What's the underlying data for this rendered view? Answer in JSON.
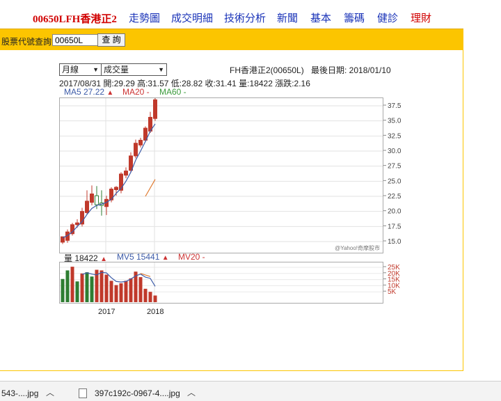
{
  "nav": {
    "stock_title": "00650LFH香港正2",
    "links": [
      "走勢圖",
      "成交明細",
      "技術分析",
      "新聞",
      "基本",
      "籌碼",
      "健診",
      "理財"
    ]
  },
  "search": {
    "label": "股票代號查詢",
    "value": "00650L",
    "button": "查 詢"
  },
  "chart": {
    "period_select": "月線",
    "indicator_select": "成交量",
    "stock_name": "FH香港正2(00650L)",
    "last_date_label": "最後日期: 2018/01/10",
    "ohlc_line": "2017/08/31 開:29.29 高:31.57 低:28.82 收:31.41 量:18422 漲跌:2.16",
    "ma5": "MA5 27.22",
    "ma20": "MA20 -",
    "ma60": "MA60 -",
    "vol_label": "量 18422",
    "mv5": "MV5 15441",
    "mv20": "MV20 -",
    "watermark": "@Yahoo!奇摩股市",
    "price_ticks": [
      "37.5",
      "35.0",
      "32.5",
      "30.0",
      "27.5",
      "25.0",
      "22.5",
      "20.0",
      "17.5",
      "15.0"
    ],
    "volume_ticks": [
      "25K",
      "20K",
      "15K",
      "10K",
      "5K"
    ],
    "x_ticks": [
      "2017",
      "2018"
    ]
  },
  "chart_data": {
    "type": "candlestick",
    "price_axis": [
      15.0,
      37.5
    ],
    "volume_axis_k": [
      0,
      25
    ],
    "candles": [
      [
        15.8,
        14.9,
        15.6,
        14.6,
        "up"
      ],
      [
        15.2,
        16.6,
        17.0,
        14.8,
        "up"
      ],
      [
        16.3,
        17.8,
        18.1,
        16.0,
        "up"
      ],
      [
        17.8,
        18.1,
        18.7,
        17.3,
        "up"
      ],
      [
        17.9,
        20.0,
        20.6,
        17.5,
        "up"
      ],
      [
        19.8,
        21.7,
        23.5,
        19.5,
        "up"
      ],
      [
        21.5,
        22.9,
        24.3,
        21.0,
        "up"
      ],
      [
        22.6,
        21.1,
        24.2,
        20.4,
        "down"
      ],
      [
        21.0,
        21.4,
        23.5,
        19.3,
        "down"
      ],
      [
        20.8,
        22.0,
        22.6,
        19.4,
        "up"
      ],
      [
        21.9,
        23.7,
        24.0,
        21.5,
        "up"
      ],
      [
        23.6,
        24.0,
        24.2,
        22.6,
        "up"
      ],
      [
        23.5,
        26.2,
        26.5,
        23.0,
        "up"
      ],
      [
        26.0,
        26.7,
        27.3,
        25.5,
        "up"
      ],
      [
        26.8,
        29.2,
        29.8,
        26.4,
        "up"
      ],
      [
        29.2,
        31.3,
        31.9,
        28.8,
        "up"
      ],
      [
        31.0,
        31.8,
        32.2,
        30.6,
        "up"
      ],
      [
        31.8,
        33.8,
        34.1,
        31.5,
        "up"
      ],
      [
        33.3,
        35.6,
        36.5,
        33.0,
        "up"
      ],
      [
        35.4,
        38.5,
        38.8,
        35.0,
        "up"
      ]
    ],
    "ma5": [
      15.6,
      16.0,
      16.6,
      17.5,
      18.3,
      19.5,
      20.5,
      21.0,
      21.2,
      21.5,
      22.0,
      23.0,
      23.8,
      25.0,
      26.5,
      28.5,
      30.0,
      31.6,
      33.3,
      34.5
    ],
    "ma20_partial": [
      [
        17,
        22.5
      ],
      [
        19,
        25.3
      ]
    ],
    "volume_k": [
      15.5,
      22.5,
      25.5,
      13.5,
      20.0,
      21.0,
      17.5,
      23.0,
      22.5,
      19.0,
      14.0,
      10.5,
      12.0,
      14.0,
      16.0,
      21.5,
      17.0,
      7.5,
      5.0,
      2.0
    ],
    "volume_colors": [
      "green",
      "green",
      "red",
      "green",
      "red",
      "green",
      "green",
      "red",
      "red",
      "red",
      "red",
      "red",
      "red",
      "red",
      "red",
      "red",
      "red",
      "red",
      "red",
      "red"
    ],
    "mv5": [
      null,
      null,
      null,
      null,
      19.2,
      20.5,
      19.5,
      18.8,
      20.9,
      20.5,
      16.5,
      13.5,
      13.0,
      13.5,
      15.5,
      18.0,
      19.5,
      17.0,
      16.0,
      9.5
    ],
    "mv20_partial": [
      [
        16,
        20.0
      ],
      [
        18,
        17.5
      ]
    ]
  },
  "downloads": {
    "item1": "543-....jpg",
    "item2": "397c192c-0967-4....jpg"
  }
}
